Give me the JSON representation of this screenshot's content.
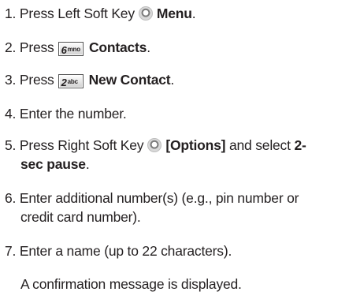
{
  "steps": [
    {
      "num": "1.",
      "text": "Press Left Soft Key",
      "icon": "soft-key-circle",
      "bold": "Menu",
      "end": "."
    },
    {
      "num": "2.",
      "text": "Press",
      "key": {
        "digit": "6",
        "letters": "mno"
      },
      "bold": "Contacts",
      "end": "."
    },
    {
      "num": "3.",
      "text": "Press",
      "key": {
        "digit": "2",
        "letters": "abc"
      },
      "bold": "New Contact",
      "end": "."
    },
    {
      "num": "4.",
      "text": "Enter the number."
    },
    {
      "num": "5.",
      "text": "Press Right Soft Key",
      "icon": "soft-key-circle",
      "bold": "[Options]",
      "middle": "and select",
      "bold2_line1": "2-",
      "bold2_line2": "sec pause",
      "end": "."
    },
    {
      "num": "6.",
      "line1": "Enter additional number(s) (e.g., pin number or",
      "line2": "credit card number)."
    },
    {
      "num": "7.",
      "text": "Enter a name (up to 22 characters)."
    }
  ],
  "note": "A confirmation message is displayed."
}
